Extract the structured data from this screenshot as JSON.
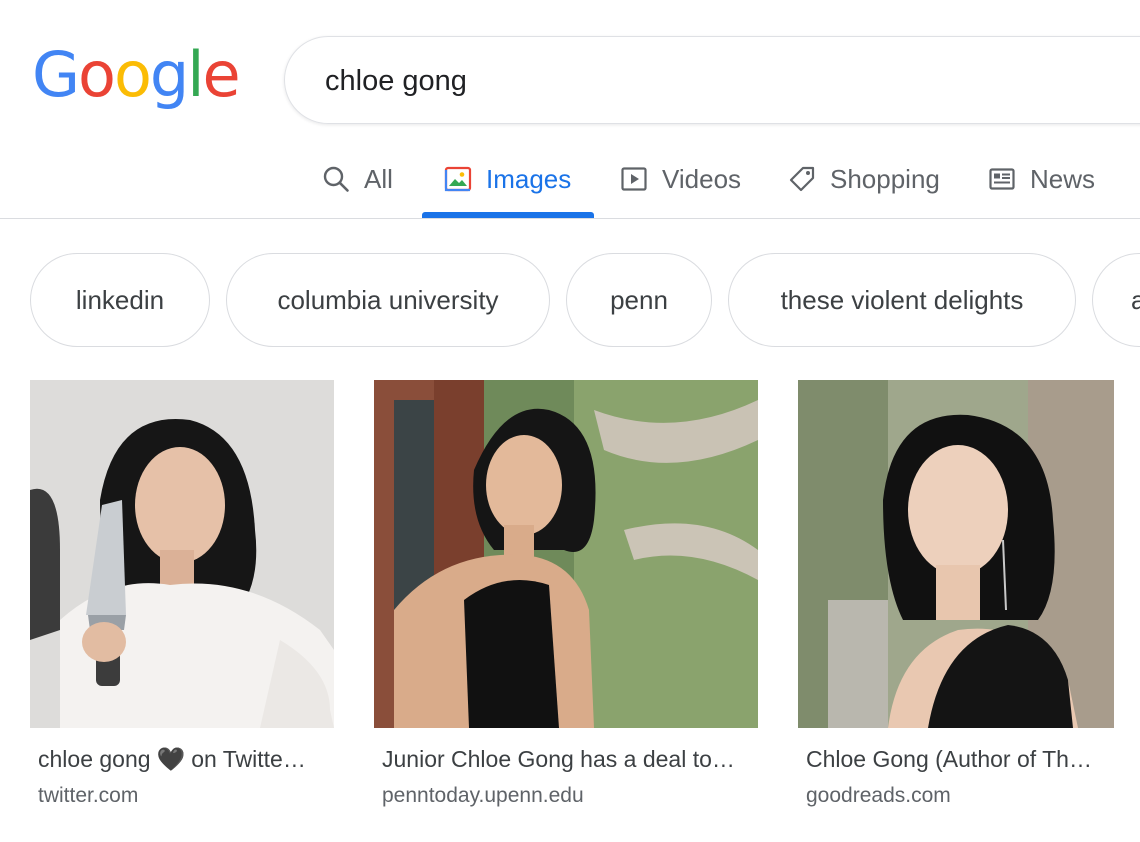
{
  "logo": {
    "letters": [
      "G",
      "o",
      "o",
      "g",
      "l",
      "e"
    ],
    "colors": [
      "#4285F4",
      "#EA4335",
      "#FBBC05",
      "#4285F4",
      "#34A853",
      "#EA4335"
    ]
  },
  "search": {
    "query": "chloe gong"
  },
  "tabs": [
    {
      "label": "All",
      "icon": "search-icon",
      "active": false
    },
    {
      "label": "Images",
      "icon": "images-icon",
      "active": true
    },
    {
      "label": "Videos",
      "icon": "video-icon",
      "active": false
    },
    {
      "label": "Shopping",
      "icon": "tag-icon",
      "active": false
    },
    {
      "label": "News",
      "icon": "news-icon",
      "active": false
    }
  ],
  "chips": [
    "linkedin",
    "columbia university",
    "penn",
    "these violent delights",
    "a"
  ],
  "results": [
    {
      "title_before": "chloe gong",
      "title_heart": "🖤",
      "title_after": "on Twitte…",
      "source": "twitter.com"
    },
    {
      "title": "Junior Chloe Gong has a deal to…",
      "source": "penntoday.upenn.edu"
    },
    {
      "title": "Chloe Gong (Author of Th…",
      "source": "goodreads.com"
    }
  ],
  "colors": {
    "accent": "#1a73e8",
    "border": "#dadce0",
    "muted": "#5f6368"
  }
}
